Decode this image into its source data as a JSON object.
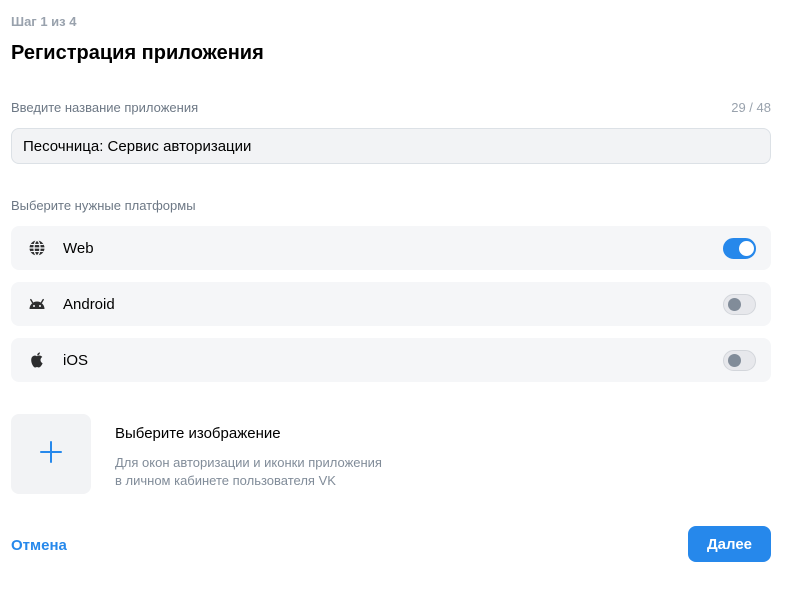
{
  "step": "Шаг 1 из 4",
  "title": "Регистрация приложения",
  "name_field": {
    "label": "Введите название приложения",
    "counter": "29 / 48",
    "value": "Песочница: Сервис авторизации"
  },
  "platforms": {
    "label": "Выберите нужные платформы",
    "items": [
      {
        "name": "Web",
        "icon": "globe-icon",
        "enabled": true
      },
      {
        "name": "Android",
        "icon": "android-icon",
        "enabled": false
      },
      {
        "name": "iOS",
        "icon": "apple-icon",
        "enabled": false
      }
    ]
  },
  "image": {
    "title": "Выберите изображение",
    "description_line1": "Для окон авторизации и иконки приложения",
    "description_line2": "в личном кабинете пользователя VK"
  },
  "actions": {
    "cancel": "Отмена",
    "next": "Далее"
  },
  "colors": {
    "accent": "#2688eb",
    "muted": "#99a2ad"
  }
}
